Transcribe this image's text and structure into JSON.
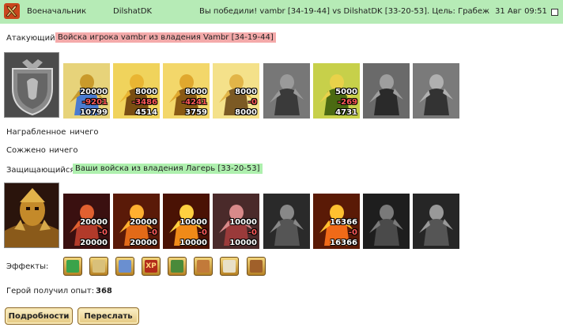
{
  "header": {
    "rank": "Военачальник",
    "player": "DilshatDK",
    "result": "Вы победили! vambr [34-19-44] vs DilshatDK [33-20-53]. Цель: Грабеж",
    "datetime": "31 Авг 09:51"
  },
  "attacker": {
    "label": "Атакующий",
    "tag": "Войска игрока vambr из владения Vambr [34-19-44]",
    "units": [
      {
        "name": "unit-1",
        "n1": "20000",
        "n2": "-9201",
        "n3": "10799"
      },
      {
        "name": "unit-2",
        "n1": "8000",
        "n2": "-3486",
        "n3": "4514"
      },
      {
        "name": "unit-3",
        "n1": "8000",
        "n2": "-4241",
        "n3": "3759"
      },
      {
        "name": "unit-4",
        "n1": "8000",
        "n2": "-0",
        "n3": "8000"
      },
      {
        "name": "unit-5",
        "n1": "",
        "n2": "",
        "n3": ""
      },
      {
        "name": "unit-6",
        "n1": "5000",
        "n2": "-269",
        "n3": "4731"
      },
      {
        "name": "unit-7",
        "n1": "",
        "n2": "",
        "n3": ""
      },
      {
        "name": "unit-8",
        "n1": "",
        "n2": "",
        "n3": ""
      }
    ]
  },
  "loot": {
    "label": "Награбленное",
    "value": "ничего"
  },
  "burned": {
    "label": "Сожжено",
    "value": "ничего"
  },
  "defender": {
    "label": "Защищающийся",
    "tag": "Ваши войска из владения Лагерь [33-20-53]",
    "units": [
      {
        "name": "unit-1",
        "n1": "20000",
        "n2": "-0",
        "n3": "20000"
      },
      {
        "name": "unit-2",
        "n1": "20000",
        "n2": "-0",
        "n3": "20000"
      },
      {
        "name": "unit-3",
        "n1": "10000",
        "n2": "-0",
        "n3": "10000"
      },
      {
        "name": "unit-4",
        "n1": "10000",
        "n2": "-0",
        "n3": "10000"
      },
      {
        "name": "unit-5",
        "n1": "",
        "n2": "",
        "n3": ""
      },
      {
        "name": "unit-6",
        "n1": "16366",
        "n2": "-0",
        "n3": "16366"
      },
      {
        "name": "unit-7",
        "n1": "",
        "n2": "",
        "n3": ""
      },
      {
        "name": "unit-8",
        "n1": "",
        "n2": "",
        "n3": ""
      }
    ]
  },
  "effects": {
    "label": "Эффекты:",
    "icons": [
      "sword-icon",
      "scroll-icon",
      "hand-magic-icon",
      "xp-icon",
      "xp-book-icon",
      "axe-icon",
      "dice-icon",
      "chest-icon"
    ],
    "xp_text": "XP"
  },
  "experience": {
    "label": "Герой получил опыт:",
    "value": "368"
  },
  "buttons": {
    "details": "Подробности",
    "forward": "Переслать"
  },
  "colors": {
    "header_bg": "#b6ebb6",
    "attacker_tag": "#f4aaaa",
    "defender_tag": "#aef0ae"
  }
}
